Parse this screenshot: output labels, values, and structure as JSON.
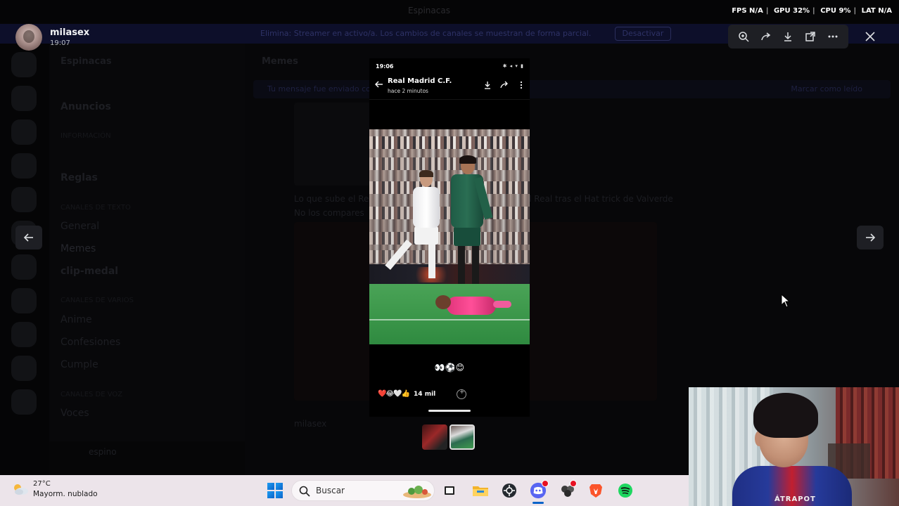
{
  "hud": {
    "fps_label": "FPS",
    "fps_value": "N/A",
    "gpu_label": "GPU",
    "gpu_value": "32%",
    "cpu_label": "CPU",
    "cpu_value": "9%",
    "lat_label": "LAT",
    "lat_value": "N/A"
  },
  "background": {
    "window_title": "Espinacas",
    "banner_text": "Elimina: Streamer en activo/a. Los cambios de canales se muestran de forma parcial.",
    "banner_button": "Desactivar",
    "server_name": "Espinacas",
    "channels": [
      {
        "label": "Anuncios",
        "kind": "channel"
      },
      {
        "label": "INFORMACIÓN",
        "kind": "category"
      },
      {
        "label": "Reglas",
        "kind": "channel"
      },
      {
        "label": "CANALES DE TEXTO",
        "kind": "category"
      },
      {
        "label": "General",
        "kind": "channel"
      },
      {
        "label": "Memes",
        "kind": "active"
      },
      {
        "label": "clip-medal",
        "kind": "channel"
      },
      {
        "label": "CANALES DE VARIOS",
        "kind": "category"
      },
      {
        "label": "Anime",
        "kind": "channel"
      },
      {
        "label": "Confesiones",
        "kind": "channel"
      },
      {
        "label": "Cumple",
        "kind": "channel"
      },
      {
        "label": "CANALES DE VOZ",
        "kind": "category"
      },
      {
        "label": "Voces",
        "kind": "channel"
      }
    ],
    "self_user": "espino",
    "chat_channel": "Memes",
    "thread_notice": "Tu mensaje fue enviado correctamente",
    "thread_right": "Marcar como leído",
    "message_line1": "Lo que sube el Real en el último minuto / Lo que sube el Real tras el Hat trick de Valverde",
    "message_line2": "No los compares",
    "next_author": "milasex"
  },
  "viewer": {
    "author": "milasex",
    "time": "19:07",
    "toolbar_icons": [
      "zoom-icon",
      "forward-icon",
      "download-icon",
      "open-external-icon",
      "more-icon"
    ],
    "close_icon": "close-icon",
    "prev_icon": "arrow-left-icon",
    "next_icon": "arrow-right-icon"
  },
  "phone": {
    "status_time": "19:06",
    "channel_name": "Real Madrid C.F.",
    "posted": "hace 2 minutos",
    "caption": "👀⚽😊",
    "reaction_emojis": "❤️😂🤍👍",
    "reaction_count": "14 mil"
  },
  "taskbar": {
    "temperature": "27°C",
    "weather": "Mayorm. nublado",
    "search_placeholder": "Buscar",
    "apps": [
      "windows-start-icon",
      "task-view-icon",
      "file-explorer-icon",
      "github-icon",
      "discord-icon",
      "davinci-resolve-icon",
      "brave-icon",
      "spotify-icon"
    ]
  },
  "webcam": {
    "shirt_text": "ÁTRAPOT"
  },
  "colors": {
    "overlay_bg": "#000000",
    "toolbar_bg": "#1e1f24",
    "taskbar_bg": "#ece4ea",
    "accent_blue": "#0a63c9",
    "spotify_green": "#1ed760",
    "discord_blurple": "#5865f2"
  }
}
